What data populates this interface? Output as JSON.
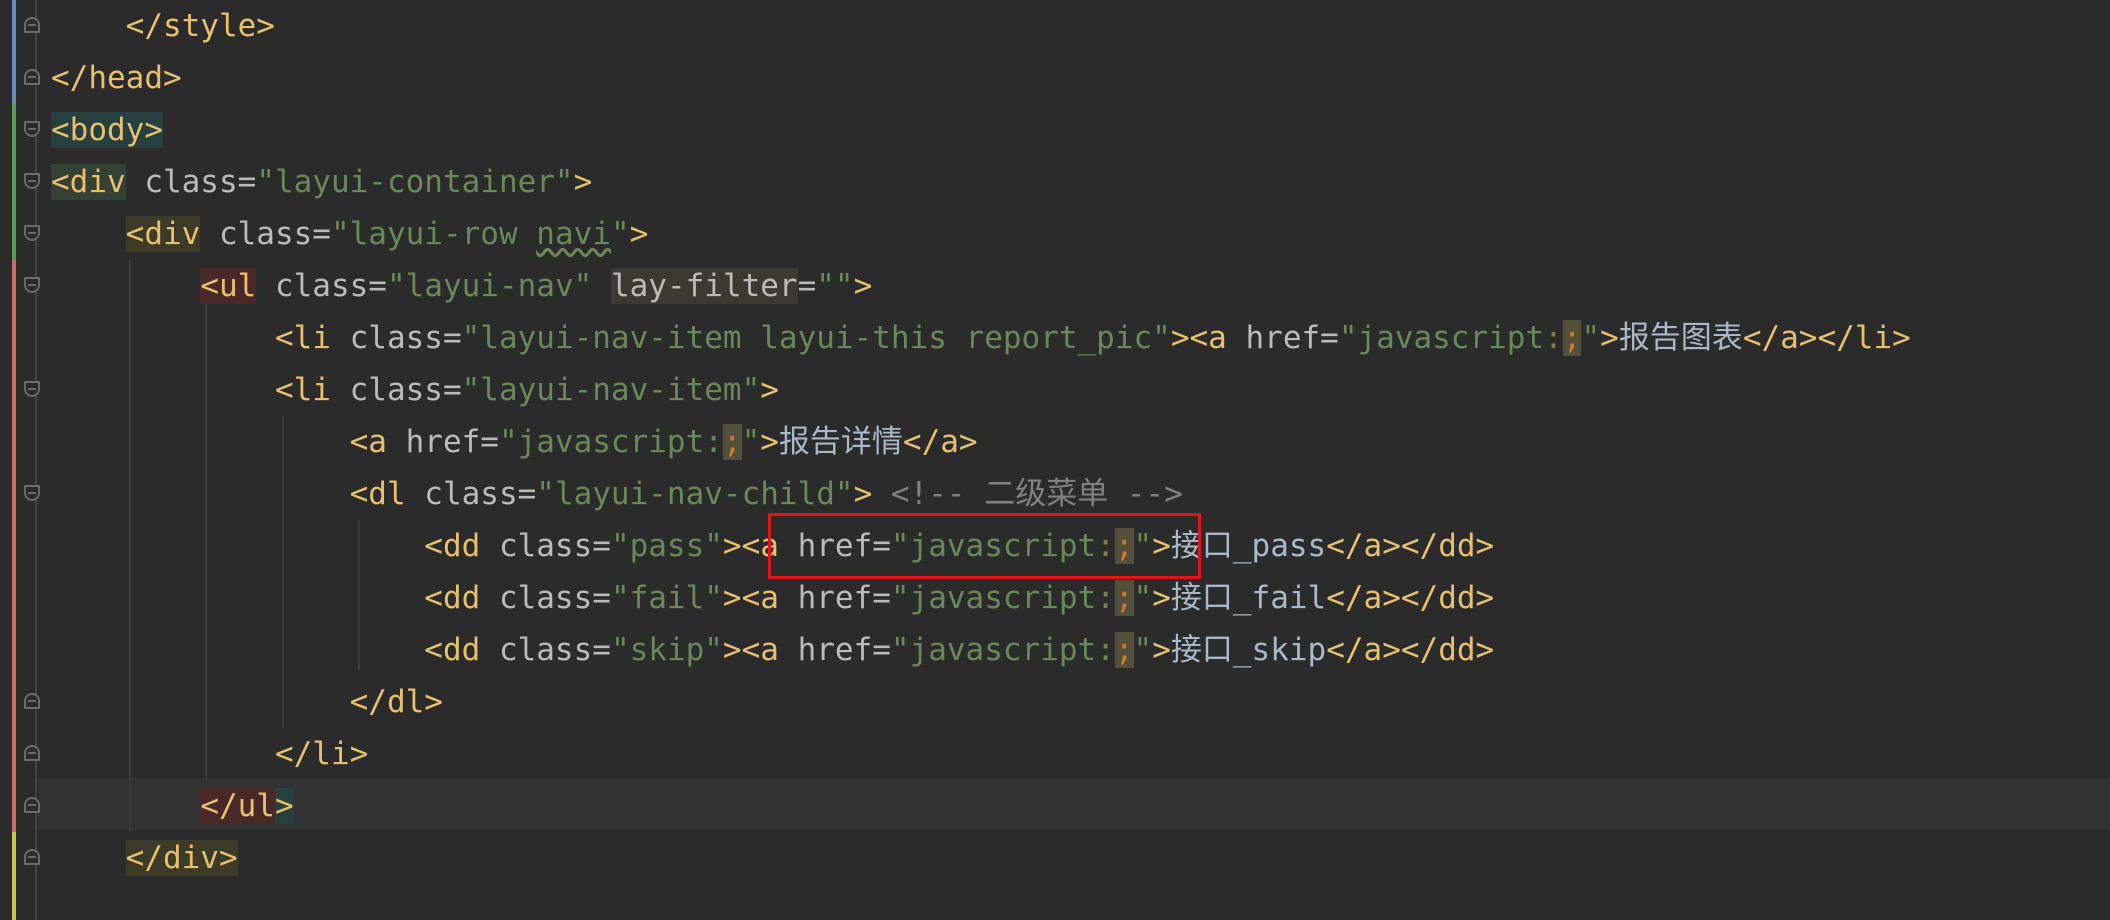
{
  "lines": [
    {
      "indent": "    ",
      "tag_open": "</style>"
    },
    {
      "tag_open": "</head>"
    },
    {
      "tag_open": "<body>"
    },
    {
      "tag": "<div",
      "attr": " class=",
      "value": "\"layui-container\"",
      "close": ">"
    },
    {
      "indent": "    ",
      "tag": "<div",
      "attr": " class=",
      "value_a": "\"layui-row ",
      "value_b": "navi",
      "value_c": "\"",
      "close": ">"
    },
    {
      "indent": "        ",
      "tag": "<ul",
      "attr": " class=",
      "value": "\"layui-nav\"",
      "space": " ",
      "attr2": "lay-filter",
      "eq": "=",
      "value2": "\"\"",
      "close": ">"
    },
    {
      "indent": "            ",
      "tag": "<li",
      "attr": " class=",
      "value": "\"layui-nav-item layui-this report_pic\"",
      "close": "><a",
      "attr2": " href=",
      "value2_a": "\"javascript:",
      "semi": ";",
      "value2_b": "\"",
      "close2": ">",
      "text": "报告图表",
      "end": "</a></li>"
    },
    {
      "indent": "            ",
      "tag": "<li",
      "attr": " class=",
      "value": "\"layui-nav-item\"",
      "close": ">"
    },
    {
      "indent": "                ",
      "tag": "<a",
      "attr": " href=",
      "value_a": "\"javascript:",
      "semi": ";",
      "value_b": "\"",
      "close": ">",
      "text": "报告详情",
      "end": "</a>"
    },
    {
      "indent": "                ",
      "tag": "<dl",
      "attr": " class=",
      "value": "\"layui-nav-child\"",
      "close": ">",
      "comment": " <!-- 二级菜单 -->"
    },
    {
      "indent": "                    ",
      "tag": "<dd",
      "attr": " class=",
      "value": "\"pass\"",
      "close": "><a",
      "attr2": " href=",
      "value2_a": "\"javascript:",
      "semi": ";",
      "value2_b": "\"",
      "close2": ">",
      "text": "接口_pass",
      "end": "</a></dd>"
    },
    {
      "indent": "                    ",
      "tag": "<dd",
      "attr": " class=",
      "value": "\"fail\"",
      "close": "><a",
      "attr2": " href=",
      "value2_a": "\"javascript:",
      "semi": ";",
      "value2_b": "\"",
      "close2": ">",
      "text": "接口_fail",
      "end": "</a></dd>"
    },
    {
      "indent": "                    ",
      "tag": "<dd",
      "attr": " class=",
      "value": "\"skip\"",
      "close": "><a",
      "attr2": " href=",
      "value2_a": "\"javascript:",
      "semi": ";",
      "value2_b": "\"",
      "close2": ">",
      "text": "接口_skip",
      "end": "</a></dd>"
    },
    {
      "indent": "                ",
      "tag_open": "</dl>"
    },
    {
      "indent": "            ",
      "tag_open": "</li>"
    },
    {
      "indent": "        ",
      "tag_a": "</ul",
      "tag_b": ">"
    },
    {
      "indent": "    ",
      "tag_open": "</div>"
    }
  ],
  "colors": {
    "background": "#2b2b2b",
    "tag": "#e8bf6a",
    "attribute": "#bababa",
    "string": "#6a8759",
    "comment": "#808080",
    "text": "#a9b7c6",
    "semicolon": "#cc7832",
    "highlight_box": "#e0141b"
  }
}
